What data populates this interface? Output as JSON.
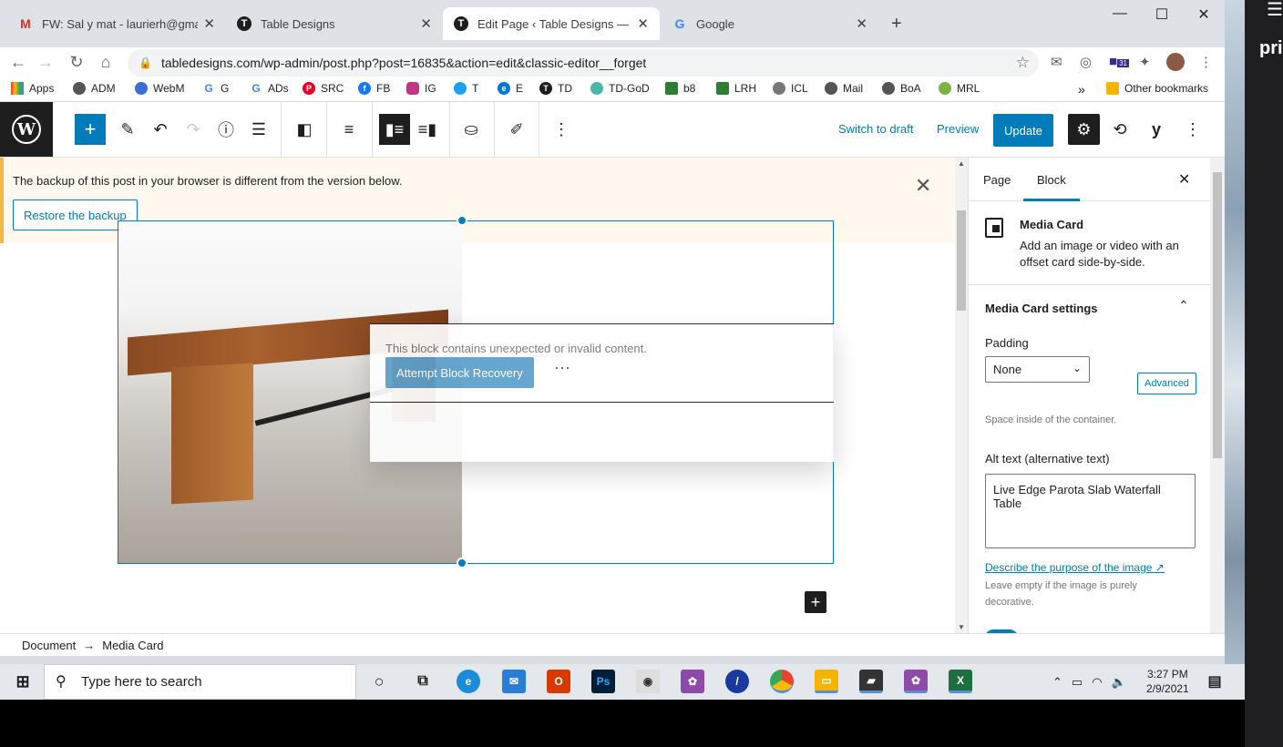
{
  "browser": {
    "tabs": [
      {
        "title": "FW: Sal y mat - laurierh@gmail.co",
        "icon": "gmail-icon"
      },
      {
        "title": "Table Designs",
        "icon": "td-icon"
      },
      {
        "title": "Edit Page ‹ Table Designs — Wor",
        "icon": "td-icon"
      },
      {
        "title": "Google",
        "icon": "google-icon"
      }
    ],
    "new_tab": "+",
    "url": "tabledesigns.com/wp-admin/post.php?post=16835&action=edit&classic-editor__forget",
    "calendar_badge": "31",
    "bookmarks": [
      "Apps",
      "ADM",
      "WebM",
      "G",
      "ADs",
      "SRC",
      "FB",
      "IG",
      "T",
      "E",
      "TD",
      "TD-GoD",
      "b8",
      "LRH",
      "ICL",
      "Mail",
      "BoA",
      "MRL"
    ],
    "bookmarks_more": "»",
    "other_bookmarks": "Other bookmarks"
  },
  "wp_toolbar": {
    "switch_to_draft": "Switch to draft",
    "preview": "Preview",
    "update": "Update"
  },
  "notice": {
    "message": "The backup of this post in your browser is different from the version below.",
    "restore_button": "Restore the backup"
  },
  "invalid_block": {
    "message": "This block contains unexpected or invalid content.",
    "recover_button": "Attempt Block Recovery",
    "more": "⋯"
  },
  "sidebar": {
    "tab_page": "Page",
    "tab_block": "Block",
    "block_title": "Media Card",
    "block_desc": "Add an image or video with an offset card side-by-side.",
    "panel_title": "Media Card settings",
    "padding_label": "Padding",
    "padding_value": "None",
    "advanced": "Advanced",
    "padding_help": "Space inside of the container.",
    "alt_label": "Alt text (alternative text)",
    "alt_value": "Live Edge Parota Slab Waterfall Table",
    "alt_link": "Describe the purpose of the image",
    "alt_help": "Leave empty if the image is purely decorative."
  },
  "breadcrumb": {
    "root": "Document",
    "arrow": "→",
    "current": "Media Card"
  },
  "taskbar": {
    "search_placeholder": "Type here to search",
    "time": "3:27 PM",
    "date": "2/9/2021"
  },
  "side_panel": {
    "text": "pri"
  },
  "colors": {
    "wp_blue": "#007cba",
    "notice_bg": "#fef8ee",
    "notice_border": "#f0b849",
    "toolbar_dark": "#1e1e1e"
  }
}
